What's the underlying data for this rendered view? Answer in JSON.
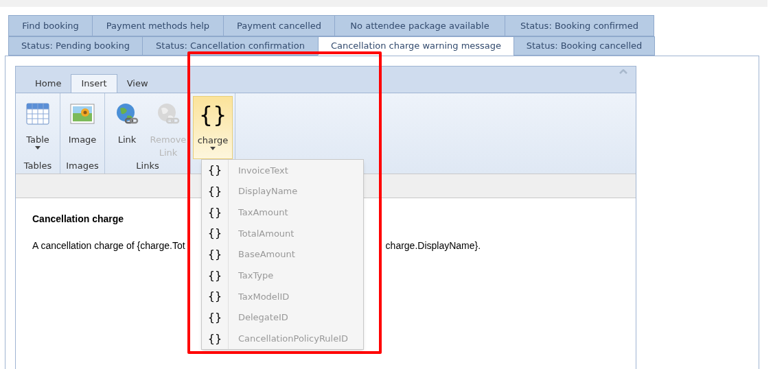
{
  "tab_rows": [
    [
      {
        "label": "Find booking",
        "selected": false
      },
      {
        "label": "Payment methods help",
        "selected": false
      },
      {
        "label": "Payment cancelled",
        "selected": false
      },
      {
        "label": "No attendee package available",
        "selected": false
      },
      {
        "label": "Status: Booking confirmed",
        "selected": false
      }
    ],
    [
      {
        "label": "Status: Pending booking",
        "selected": false
      },
      {
        "label": "Status: Cancellation confirmation",
        "selected": false
      },
      {
        "label": "Cancellation charge warning message",
        "selected": true
      },
      {
        "label": "Status: Booking cancelled",
        "selected": false
      }
    ]
  ],
  "ribbon": {
    "tabs": [
      {
        "label": "Home",
        "selected": false
      },
      {
        "label": "Insert",
        "selected": true
      },
      {
        "label": "View",
        "selected": false
      }
    ],
    "groups": [
      {
        "label": "Tables",
        "buttons": [
          {
            "kind": "table",
            "label": "Table",
            "dropdown": true,
            "disabled": false,
            "active": false
          }
        ]
      },
      {
        "label": "Images",
        "buttons": [
          {
            "kind": "image",
            "label": "Image",
            "dropdown": false,
            "disabled": false,
            "active": false
          }
        ]
      },
      {
        "label": "Links",
        "buttons": [
          {
            "kind": "link",
            "label": "Link",
            "dropdown": false,
            "disabled": false,
            "active": false
          },
          {
            "kind": "unlink",
            "label": "Remove Link",
            "dropdown": false,
            "disabled": true,
            "active": false
          }
        ]
      },
      {
        "buttons": [
          {
            "kind": "braces",
            "icon": "{}",
            "label": "charge",
            "dropdown": true,
            "disabled": false,
            "active": true
          }
        ]
      }
    ]
  },
  "dropdown": {
    "items": [
      {
        "icon": "{}",
        "label": "InvoiceText"
      },
      {
        "icon": "{}",
        "label": "DisplayName"
      },
      {
        "icon": "{}",
        "label": "TaxAmount"
      },
      {
        "icon": "{}",
        "label": "TotalAmount"
      },
      {
        "icon": "{}",
        "label": "BaseAmount"
      },
      {
        "icon": "{}",
        "label": "TaxType"
      },
      {
        "icon": "{}",
        "label": "TaxModelID"
      },
      {
        "icon": "{}",
        "label": "DelegateID"
      },
      {
        "icon": "{}",
        "label": "CancellationPolicyRuleID"
      }
    ]
  },
  "document": {
    "heading": "Cancellation charge",
    "paragraph_start": "A cancellation charge of {charge.Tot",
    "paragraph_end": "charge.DisplayName}."
  }
}
